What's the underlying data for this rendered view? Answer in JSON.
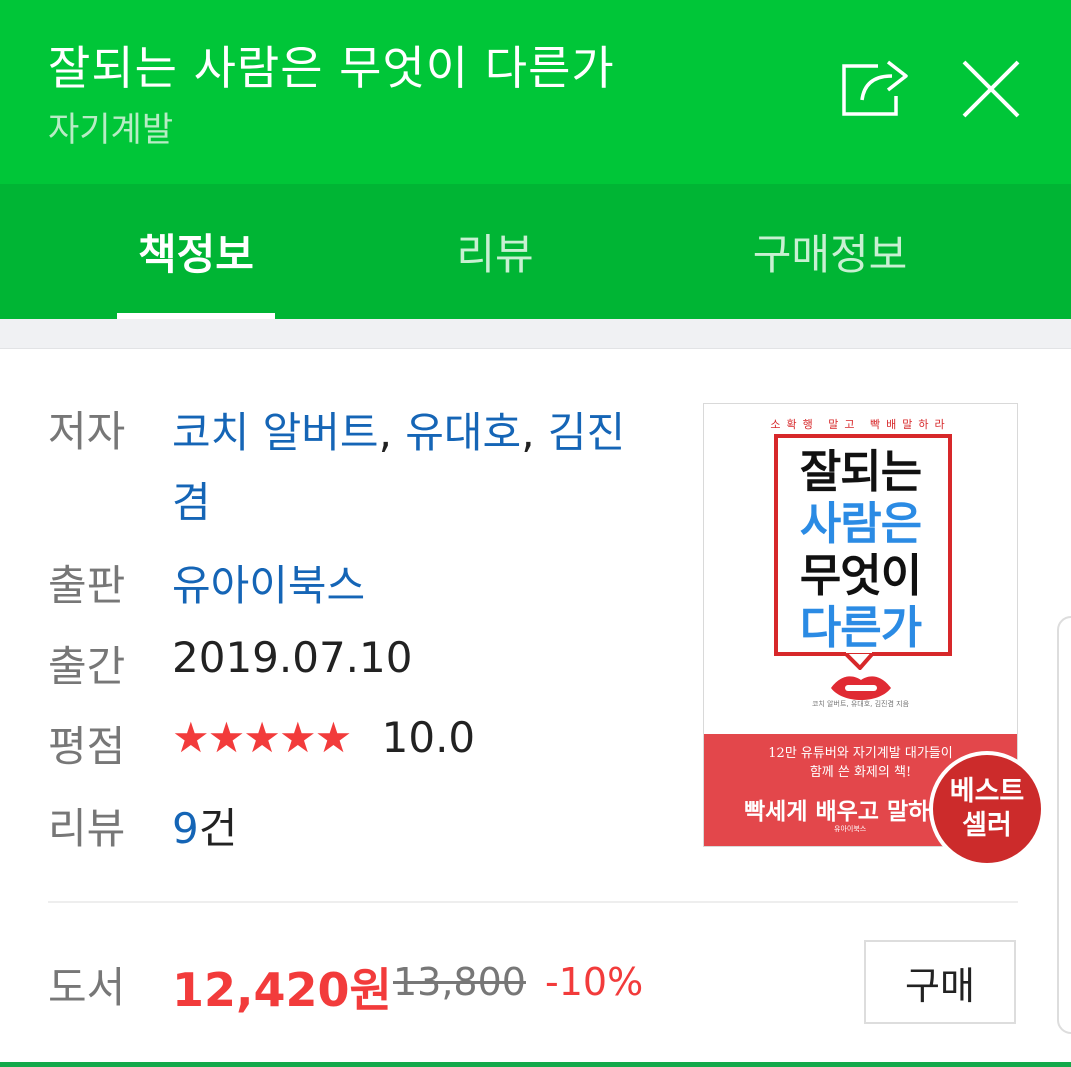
{
  "header": {
    "title": "잘되는 사람은 무엇이 다른가",
    "category": "자기계발",
    "share_icon": "share-icon",
    "close_icon": "close-icon"
  },
  "tabs": [
    {
      "label": "책정보",
      "active": true
    },
    {
      "label": "리뷰",
      "active": false
    },
    {
      "label": "구매정보",
      "active": false
    }
  ],
  "info": {
    "author_label": "저자",
    "author_name_1": "코치 알버트",
    "author_name_2": "유대호",
    "author_name_3": "김진겸",
    "author_sep": ", ",
    "publisher_label": "출판",
    "publisher": "유아이북스",
    "date_label": "출간",
    "date": "2019.07.10",
    "rating_label": "평점",
    "rating_stars": "★★★★★",
    "rating_value": "10.0",
    "rating": 10.0,
    "review_label": "리뷰",
    "review_count": "9",
    "review_unit": "건"
  },
  "cover": {
    "tagline": "소확행 말고 빡배말하라",
    "title_line_1": "잘되는",
    "title_line_2": "사람은",
    "title_line_3": "무엇이",
    "title_line_4": "다른가",
    "authors": "코치 알버트, 유대호, 김진겸 지음",
    "blurb_line_1": "12만 유튜버와 자기계발 대가들이",
    "blurb_line_2": "함께 쓴 화제의 책!",
    "slogan": "빡세게 배우고 말하기",
    "publisher_logo": "유아이북스",
    "badge_line_1": "베스트",
    "badge_line_2": "셀러"
  },
  "price": {
    "label": "도서",
    "sale_price": "12,420원",
    "original_price": "13,800",
    "discount": "-10%",
    "buy_label": "구매"
  },
  "colors": {
    "header_green": "#00c638",
    "tab_green": "#00b534",
    "link_blue": "#1565b6",
    "price_red": "#f23b3b",
    "badge_red": "#cc2b2b"
  }
}
